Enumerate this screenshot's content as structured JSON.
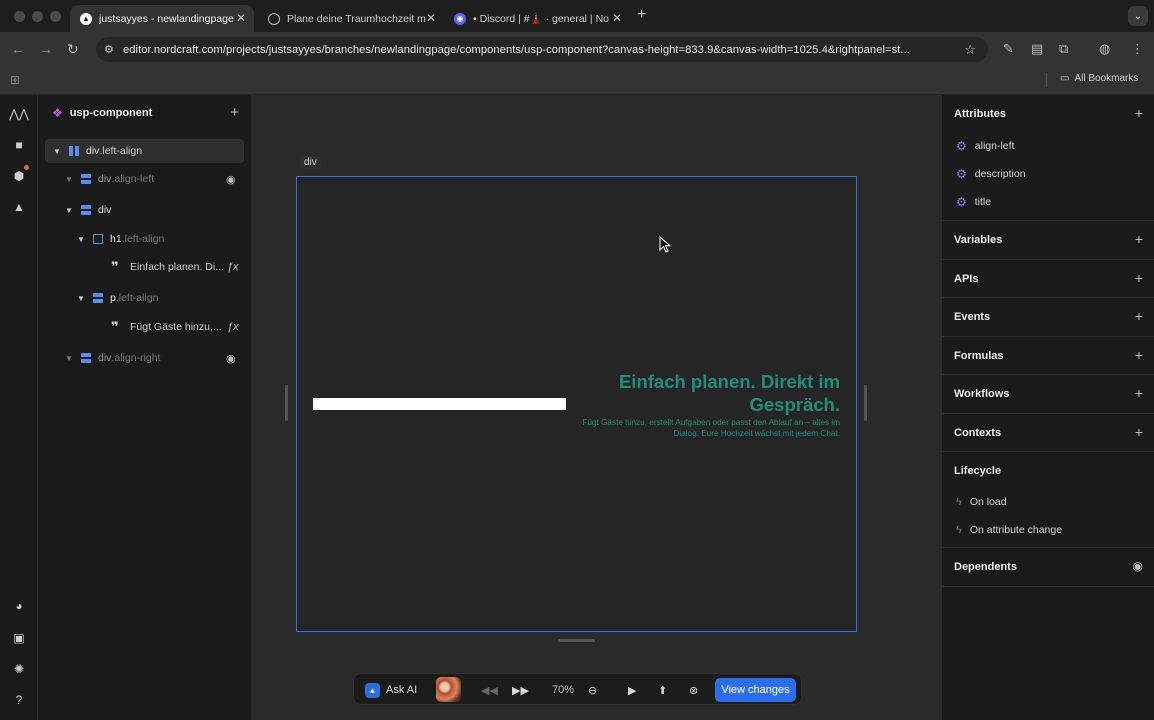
{
  "browser": {
    "tabs": [
      {
        "label": "justsayyes - newlandingpage",
        "favicon_name": "nordcraft-icon",
        "active": true
      },
      {
        "label": "Plane deine Traumhochzeit m",
        "favicon_name": "globe-icon",
        "active": false
      },
      {
        "label": "• Discord | #🗼 · general | No",
        "favicon_name": "discord-icon",
        "active": false
      }
    ],
    "url": "editor.nordcraft.com/projects/justsayyes/branches/newlandingpage/components/usp-component?canvas-height=833.9&canvas-width=1025.4&rightpanel=st...",
    "bookmarks_label": "All Bookmarks"
  },
  "tree": {
    "component_name": "usp-component",
    "nodes": [
      {
        "tag": "div",
        "cls": ".left-align"
      },
      {
        "tag": "div",
        "cls": ".align-left"
      },
      {
        "tag": "div",
        "cls": ""
      },
      {
        "tag": "h1",
        "cls": ".left-align"
      },
      {
        "text": "Einfach planen. Di..."
      },
      {
        "tag": "p",
        "cls": ".left-align"
      },
      {
        "text": "Fügt Gäste hinzu,..."
      },
      {
        "tag": "div",
        "cls": ".align-right"
      }
    ],
    "formula_icon": "ƒx"
  },
  "canvas": {
    "selected_label": "div",
    "usp_title": "Einfach planen. Direkt im Gespräch.",
    "usp_description": "Fügt Gäste hinzu, erstellt Aufgaben oder passt den Ablauf an – alles im Dialog. Eure Hochzeit wächst mit jedem Chat.",
    "accent_color": "#1f8f77"
  },
  "bottom_bar": {
    "ask_ai": "Ask AI",
    "zoom": "70%",
    "view_changes": "View changes"
  },
  "right_panel": {
    "attributes_title": "Attributes",
    "attributes": [
      "align-left",
      "description",
      "title"
    ],
    "sections": [
      "Variables",
      "APIs",
      "Events",
      "Formulas",
      "Workflows",
      "Contexts"
    ],
    "lifecycle_title": "Lifecycle",
    "lifecycle_items": [
      "On load",
      "On attribute change"
    ],
    "dependents_title": "Dependents"
  }
}
